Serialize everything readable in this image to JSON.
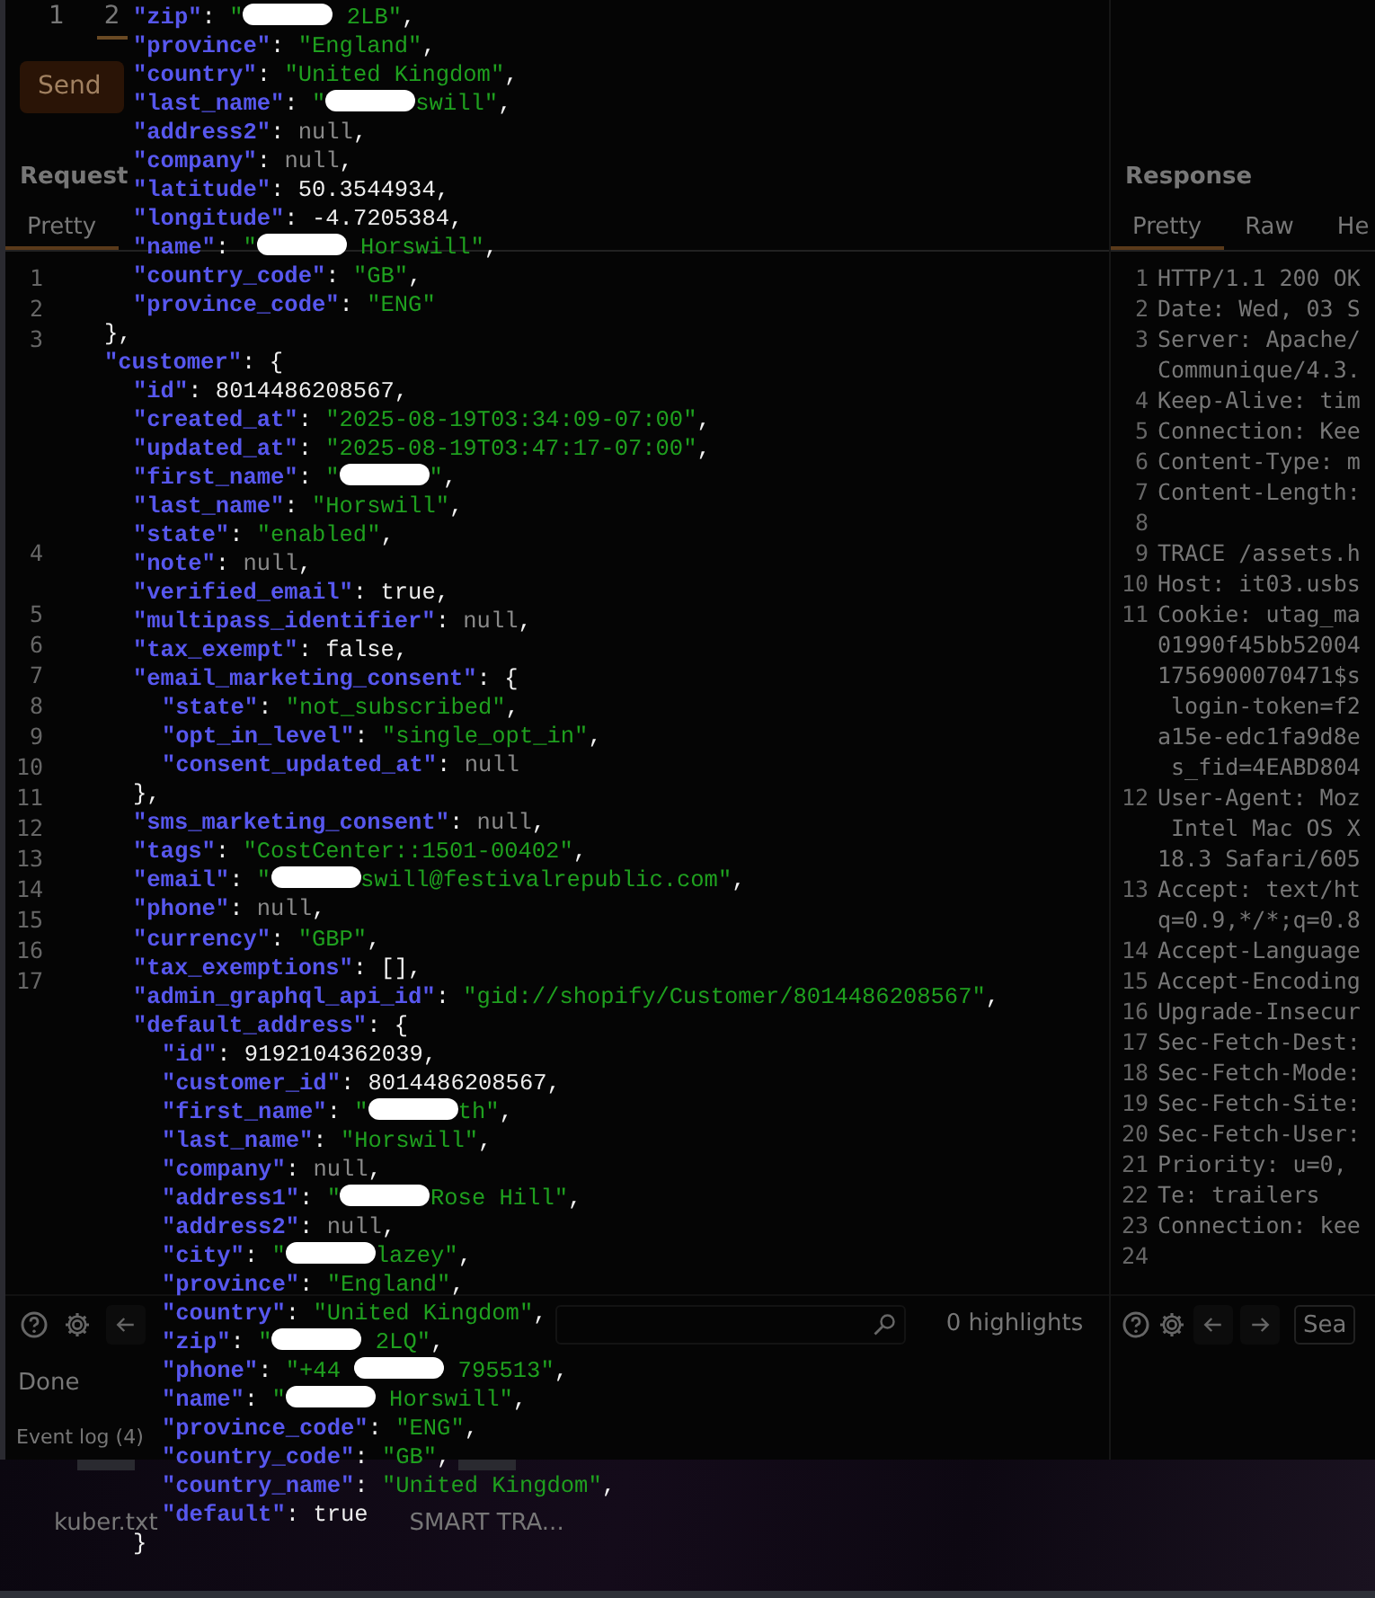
{
  "request_panel": {
    "tabs": [
      {
        "label": "1",
        "selected": false
      },
      {
        "label": "2",
        "selected": true
      }
    ],
    "send_button": "Send",
    "title": "Request",
    "view_tabs": [
      {
        "label": "Pretty",
        "selected": true
      }
    ],
    "gutter": [
      {
        "kind": "numbered",
        "number": "1"
      },
      {
        "kind": "numbered",
        "number": "2"
      },
      {
        "kind": "numbered",
        "number": "3"
      },
      {
        "kind": "continuation"
      },
      {
        "kind": "continuation"
      },
      {
        "kind": "continuation"
      },
      {
        "kind": "continuation"
      },
      {
        "kind": "continuation"
      },
      {
        "kind": "continuation"
      },
      {
        "kind": "numbered",
        "number": "4"
      },
      {
        "kind": "continuation"
      },
      {
        "kind": "numbered",
        "number": "5"
      },
      {
        "kind": "numbered",
        "number": "6"
      },
      {
        "kind": "numbered",
        "number": "7"
      },
      {
        "kind": "numbered",
        "number": "8"
      },
      {
        "kind": "numbered",
        "number": "9"
      },
      {
        "kind": "numbered",
        "number": "10"
      },
      {
        "kind": "numbered",
        "number": "11"
      },
      {
        "kind": "numbered",
        "number": "12"
      },
      {
        "kind": "numbered",
        "number": "13"
      },
      {
        "kind": "numbered",
        "number": "14"
      },
      {
        "kind": "numbered",
        "number": "15"
      },
      {
        "kind": "numbered",
        "number": "16"
      },
      {
        "kind": "numbered",
        "number": "17"
      }
    ],
    "highlights": "0 highlights",
    "status": "Done",
    "event_log": "Event log (4)"
  },
  "response_panel": {
    "title": "Response",
    "view_tabs": [
      {
        "label": "Pretty",
        "selected": true
      },
      {
        "label": "Raw",
        "selected": false
      },
      {
        "label": "He",
        "selected": false
      }
    ],
    "lines": [
      {
        "number": "1",
        "text": "HTTP/1.1 200 OK"
      },
      {
        "number": "2",
        "text": "Date: Wed, 03 S"
      },
      {
        "number": "3",
        "text": "Server: Apache/"
      },
      {
        "text": "Communique/4.3."
      },
      {
        "number": "4",
        "text": "Keep-Alive: tim"
      },
      {
        "number": "5",
        "text": "Connection: Kee"
      },
      {
        "number": "6",
        "text": "Content-Type: m"
      },
      {
        "number": "7",
        "text": "Content-Length:"
      },
      {
        "number": "8"
      },
      {
        "number": "9",
        "text": "TRACE /assets.h"
      },
      {
        "number": "10",
        "text": "Host: it03.usbs"
      },
      {
        "number": "11",
        "text": "Cookie: utag_ma"
      },
      {
        "text": "01990f45bb52004"
      },
      {
        "text": "1756900070471$s"
      },
      {
        "text": " login-token=f2"
      },
      {
        "text": "a15e-edc1fa9d8e"
      },
      {
        "text": " s_fid=4EABD804"
      },
      {
        "number": "12",
        "text": "User-Agent: Moz"
      },
      {
        "text": " Intel Mac OS X"
      },
      {
        "text": "18.3 Safari/605"
      },
      {
        "number": "13",
        "text": "Accept: text/ht"
      },
      {
        "text": "q=0.9,*/*;q=0.8"
      },
      {
        "number": "14",
        "text": "Accept-Language"
      },
      {
        "number": "15",
        "text": "Accept-Encoding"
      },
      {
        "number": "16",
        "text": "Upgrade-Insecur"
      },
      {
        "number": "17",
        "text": "Sec-Fetch-Dest:"
      },
      {
        "number": "18",
        "text": "Sec-Fetch-Mode:"
      },
      {
        "number": "19",
        "text": "Sec-Fetch-Site:"
      },
      {
        "number": "20",
        "text": "Sec-Fetch-User:"
      },
      {
        "number": "21",
        "text": "Priority: u=0,"
      },
      {
        "number": "22",
        "text": "Te: trailers"
      },
      {
        "number": "23",
        "text": "Connection: kee"
      },
      {
        "number": "24"
      }
    ],
    "search_placeholder": "Sea"
  },
  "desktop": {
    "files": [
      {
        "label": "kuber.txt"
      },
      {
        "label": "SMART TRA..."
      }
    ]
  },
  "json_overlay": {
    "items": [
      {
        "children": [
          {
            "tokens": [
              {
                "kind": "key",
                "t": "\"zip\""
              },
              {
                "kind": "punct",
                "t": ": "
              },
              {
                "kind": "string",
                "t": "\""
              },
              {
                "kind": "redaction"
              },
              {
                "kind": "string",
                "t": " 2LB\""
              },
              {
                "kind": "punct",
                "t": ","
              }
            ]
          },
          {
            "tokens": [
              {
                "kind": "key",
                "t": "\"province\""
              },
              {
                "kind": "punct",
                "t": ": "
              },
              {
                "kind": "string",
                "t": "\"England\""
              },
              {
                "kind": "punct",
                "t": ","
              }
            ]
          },
          {
            "tokens": [
              {
                "kind": "key",
                "t": "\"country\""
              },
              {
                "kind": "punct",
                "t": ": "
              },
              {
                "kind": "string",
                "t": "\"United Kingdom\""
              },
              {
                "kind": "punct",
                "t": ","
              }
            ]
          },
          {
            "tokens": [
              {
                "kind": "key",
                "t": "\"last_name\""
              },
              {
                "kind": "punct",
                "t": ": "
              },
              {
                "kind": "string",
                "t": "\""
              },
              {
                "kind": "redaction"
              },
              {
                "kind": "string",
                "t": "swill\""
              },
              {
                "kind": "punct",
                "t": ","
              }
            ]
          },
          {
            "tokens": [
              {
                "kind": "key",
                "t": "\"address2\""
              },
              {
                "kind": "punct",
                "t": ": "
              },
              {
                "kind": "null",
                "t": "null"
              },
              {
                "kind": "punct",
                "t": ","
              }
            ]
          },
          {
            "tokens": [
              {
                "kind": "key",
                "t": "\"company\""
              },
              {
                "kind": "punct",
                "t": ": "
              },
              {
                "kind": "null",
                "t": "null"
              },
              {
                "kind": "punct",
                "t": ","
              }
            ]
          },
          {
            "tokens": [
              {
                "kind": "key",
                "t": "\"latitude\""
              },
              {
                "kind": "punct",
                "t": ": "
              },
              {
                "kind": "number",
                "t": "50.3544934"
              },
              {
                "kind": "punct",
                "t": ","
              }
            ]
          },
          {
            "tokens": [
              {
                "kind": "key",
                "t": "\"longitude\""
              },
              {
                "kind": "punct",
                "t": ": "
              },
              {
                "kind": "number",
                "t": "-4.7205384"
              },
              {
                "kind": "punct",
                "t": ","
              }
            ]
          },
          {
            "tokens": [
              {
                "kind": "key",
                "t": "\"name\""
              },
              {
                "kind": "punct",
                "t": ": "
              },
              {
                "kind": "string",
                "t": "\""
              },
              {
                "kind": "redaction"
              },
              {
                "kind": "string",
                "t": " Horswill\""
              },
              {
                "kind": "punct",
                "t": ","
              }
            ]
          },
          {
            "tokens": [
              {
                "kind": "key",
                "t": "\"country_code\""
              },
              {
                "kind": "punct",
                "t": ": "
              },
              {
                "kind": "string",
                "t": "\"GB\""
              },
              {
                "kind": "punct",
                "t": ","
              }
            ]
          },
          {
            "tokens": [
              {
                "kind": "key",
                "t": "\"province_code\""
              },
              {
                "kind": "punct",
                "t": ": "
              },
              {
                "kind": "string",
                "t": "\"ENG\""
              }
            ]
          }
        ]
      },
      {
        "tokens": [
          {
            "kind": "punct",
            "t": "},"
          }
        ]
      },
      {
        "tokens": [
          {
            "kind": "key",
            "t": "\"customer\""
          },
          {
            "kind": "punct",
            "t": ": {"
          }
        ],
        "children": [
          {
            "tokens": [
              {
                "kind": "key",
                "t": "\"id\""
              },
              {
                "kind": "punct",
                "t": ": "
              },
              {
                "kind": "number",
                "t": "8014486208567"
              },
              {
                "kind": "punct",
                "t": ","
              }
            ]
          },
          {
            "tokens": [
              {
                "kind": "key",
                "t": "\"created_at\""
              },
              {
                "kind": "punct",
                "t": ": "
              },
              {
                "kind": "string",
                "t": "\"2025-08-19T03:34:09-07:00\""
              },
              {
                "kind": "punct",
                "t": ","
              }
            ]
          },
          {
            "tokens": [
              {
                "kind": "key",
                "t": "\"updated_at\""
              },
              {
                "kind": "punct",
                "t": ": "
              },
              {
                "kind": "string",
                "t": "\"2025-08-19T03:47:17-07:00\""
              },
              {
                "kind": "punct",
                "t": ","
              }
            ]
          },
          {
            "tokens": [
              {
                "kind": "key",
                "t": "\"first_name\""
              },
              {
                "kind": "punct",
                "t": ": "
              },
              {
                "kind": "string",
                "t": "\""
              },
              {
                "kind": "redaction"
              },
              {
                "kind": "string",
                "t": "\""
              },
              {
                "kind": "punct",
                "t": ","
              }
            ]
          },
          {
            "tokens": [
              {
                "kind": "key",
                "t": "\"last_name\""
              },
              {
                "kind": "punct",
                "t": ": "
              },
              {
                "kind": "string",
                "t": "\"Horswill\""
              },
              {
                "kind": "punct",
                "t": ","
              }
            ]
          },
          {
            "tokens": [
              {
                "kind": "key",
                "t": "\"state\""
              },
              {
                "kind": "punct",
                "t": ": "
              },
              {
                "kind": "string",
                "t": "\"enabled\""
              },
              {
                "kind": "punct",
                "t": ","
              }
            ]
          },
          {
            "tokens": [
              {
                "kind": "key",
                "t": "\"note\""
              },
              {
                "kind": "punct",
                "t": ": "
              },
              {
                "kind": "null",
                "t": "null"
              },
              {
                "kind": "punct",
                "t": ","
              }
            ]
          },
          {
            "tokens": [
              {
                "kind": "key",
                "t": "\"verified_email\""
              },
              {
                "kind": "punct",
                "t": ": "
              },
              {
                "kind": "bool",
                "t": "true"
              },
              {
                "kind": "punct",
                "t": ","
              }
            ]
          },
          {
            "tokens": [
              {
                "kind": "key",
                "t": "\"multipass_identifier\""
              },
              {
                "kind": "punct",
                "t": ": "
              },
              {
                "kind": "null",
                "t": "null"
              },
              {
                "kind": "punct",
                "t": ","
              }
            ]
          },
          {
            "tokens": [
              {
                "kind": "key",
                "t": "\"tax_exempt\""
              },
              {
                "kind": "punct",
                "t": ": "
              },
              {
                "kind": "bool",
                "t": "false"
              },
              {
                "kind": "punct",
                "t": ","
              }
            ]
          },
          {
            "tokens": [
              {
                "kind": "key",
                "t": "\"email_marketing_consent\""
              },
              {
                "kind": "punct",
                "t": ": {"
              }
            ],
            "children": [
              {
                "tokens": [
                  {
                    "kind": "key",
                    "t": "\"state\""
                  },
                  {
                    "kind": "punct",
                    "t": ": "
                  },
                  {
                    "kind": "string",
                    "t": "\"not_subscribed\""
                  },
                  {
                    "kind": "punct",
                    "t": ","
                  }
                ]
              },
              {
                "tokens": [
                  {
                    "kind": "key",
                    "t": "\"opt_in_level\""
                  },
                  {
                    "kind": "punct",
                    "t": ": "
                  },
                  {
                    "kind": "string",
                    "t": "\"single_opt_in\""
                  },
                  {
                    "kind": "punct",
                    "t": ","
                  }
                ]
              },
              {
                "tokens": [
                  {
                    "kind": "key",
                    "t": "\"consent_updated_at\""
                  },
                  {
                    "kind": "punct",
                    "t": ": "
                  },
                  {
                    "kind": "null",
                    "t": "null"
                  }
                ]
              }
            ]
          },
          {
            "tokens": [
              {
                "kind": "punct",
                "t": "},"
              }
            ]
          },
          {
            "tokens": [
              {
                "kind": "key",
                "t": "\"sms_marketing_consent\""
              },
              {
                "kind": "punct",
                "t": ": "
              },
              {
                "kind": "null",
                "t": "null"
              },
              {
                "kind": "punct",
                "t": ","
              }
            ]
          },
          {
            "tokens": [
              {
                "kind": "key",
                "t": "\"tags\""
              },
              {
                "kind": "punct",
                "t": ": "
              },
              {
                "kind": "string",
                "t": "\"CostCenter::1501-00402\""
              },
              {
                "kind": "punct",
                "t": ","
              }
            ]
          },
          {
            "tokens": [
              {
                "kind": "key",
                "t": "\"email\""
              },
              {
                "kind": "punct",
                "t": ": "
              },
              {
                "kind": "string",
                "t": "\""
              },
              {
                "kind": "redaction"
              },
              {
                "kind": "string",
                "t": "swill@festivalrepublic.com\""
              },
              {
                "kind": "punct",
                "t": ","
              }
            ]
          },
          {
            "tokens": [
              {
                "kind": "key",
                "t": "\"phone\""
              },
              {
                "kind": "punct",
                "t": ": "
              },
              {
                "kind": "null",
                "t": "null"
              },
              {
                "kind": "punct",
                "t": ","
              }
            ]
          },
          {
            "tokens": [
              {
                "kind": "key",
                "t": "\"currency\""
              },
              {
                "kind": "punct",
                "t": ": "
              },
              {
                "kind": "string",
                "t": "\"GBP\""
              },
              {
                "kind": "punct",
                "t": ","
              }
            ]
          },
          {
            "tokens": [
              {
                "kind": "key",
                "t": "\"tax_exemptions\""
              },
              {
                "kind": "punct",
                "t": ": [],"
              }
            ]
          },
          {
            "tokens": [
              {
                "kind": "key",
                "t": "\"admin_graphql_api_id\""
              },
              {
                "kind": "punct",
                "t": ": "
              },
              {
                "kind": "string",
                "t": "\"gid://shopify/Customer/8014486208567\""
              },
              {
                "kind": "punct",
                "t": ","
              }
            ]
          },
          {
            "tokens": [
              {
                "kind": "key",
                "t": "\"default_address\""
              },
              {
                "kind": "punct",
                "t": ": {"
              }
            ],
            "children": [
              {
                "tokens": [
                  {
                    "kind": "key",
                    "t": "\"id\""
                  },
                  {
                    "kind": "punct",
                    "t": ": "
                  },
                  {
                    "kind": "number",
                    "t": "9192104362039"
                  },
                  {
                    "kind": "punct",
                    "t": ","
                  }
                ]
              },
              {
                "tokens": [
                  {
                    "kind": "key",
                    "t": "\"customer_id\""
                  },
                  {
                    "kind": "punct",
                    "t": ": "
                  },
                  {
                    "kind": "number",
                    "t": "8014486208567"
                  },
                  {
                    "kind": "punct",
                    "t": ","
                  }
                ]
              },
              {
                "tokens": [
                  {
                    "kind": "key",
                    "t": "\"first_name\""
                  },
                  {
                    "kind": "punct",
                    "t": ": "
                  },
                  {
                    "kind": "string",
                    "t": "\""
                  },
                  {
                    "kind": "redaction"
                  },
                  {
                    "kind": "string",
                    "t": "th\""
                  },
                  {
                    "kind": "punct",
                    "t": ","
                  }
                ]
              },
              {
                "tokens": [
                  {
                    "kind": "key",
                    "t": "\"last_name\""
                  },
                  {
                    "kind": "punct",
                    "t": ": "
                  },
                  {
                    "kind": "string",
                    "t": "\"Horswill\""
                  },
                  {
                    "kind": "punct",
                    "t": ","
                  }
                ]
              },
              {
                "tokens": [
                  {
                    "kind": "key",
                    "t": "\"company\""
                  },
                  {
                    "kind": "punct",
                    "t": ": "
                  },
                  {
                    "kind": "null",
                    "t": "null"
                  },
                  {
                    "kind": "punct",
                    "t": ","
                  }
                ]
              },
              {
                "tokens": [
                  {
                    "kind": "key",
                    "t": "\"address1\""
                  },
                  {
                    "kind": "punct",
                    "t": ": "
                  },
                  {
                    "kind": "string",
                    "t": "\""
                  },
                  {
                    "kind": "redaction"
                  },
                  {
                    "kind": "string",
                    "t": "Rose Hill\""
                  },
                  {
                    "kind": "punct",
                    "t": ","
                  }
                ]
              },
              {
                "tokens": [
                  {
                    "kind": "key",
                    "t": "\"address2\""
                  },
                  {
                    "kind": "punct",
                    "t": ": "
                  },
                  {
                    "kind": "null",
                    "t": "null"
                  },
                  {
                    "kind": "punct",
                    "t": ","
                  }
                ]
              },
              {
                "tokens": [
                  {
                    "kind": "key",
                    "t": "\"city\""
                  },
                  {
                    "kind": "punct",
                    "t": ": "
                  },
                  {
                    "kind": "string",
                    "t": "\""
                  },
                  {
                    "kind": "redaction"
                  },
                  {
                    "kind": "string",
                    "t": "lazey\""
                  },
                  {
                    "kind": "punct",
                    "t": ","
                  }
                ]
              },
              {
                "tokens": [
                  {
                    "kind": "key",
                    "t": "\"province\""
                  },
                  {
                    "kind": "punct",
                    "t": ": "
                  },
                  {
                    "kind": "string",
                    "t": "\"England\""
                  },
                  {
                    "kind": "punct",
                    "t": ","
                  }
                ]
              },
              {
                "tokens": [
                  {
                    "kind": "key",
                    "t": "\"country\""
                  },
                  {
                    "kind": "punct",
                    "t": ": "
                  },
                  {
                    "kind": "string",
                    "t": "\"United Kingdom\""
                  },
                  {
                    "kind": "punct",
                    "t": ","
                  }
                ]
              },
              {
                "tokens": [
                  {
                    "kind": "key",
                    "t": "\"zip\""
                  },
                  {
                    "kind": "punct",
                    "t": ": "
                  },
                  {
                    "kind": "string",
                    "t": "\""
                  },
                  {
                    "kind": "redaction"
                  },
                  {
                    "kind": "string",
                    "t": " 2LQ\""
                  },
                  {
                    "kind": "punct",
                    "t": ","
                  }
                ]
              },
              {
                "tokens": [
                  {
                    "kind": "key",
                    "t": "\"phone\""
                  },
                  {
                    "kind": "punct",
                    "t": ": "
                  },
                  {
                    "kind": "string",
                    "t": "\"+44 "
                  },
                  {
                    "kind": "redaction"
                  },
                  {
                    "kind": "string",
                    "t": " 795513\""
                  },
                  {
                    "kind": "punct",
                    "t": ","
                  }
                ]
              },
              {
                "tokens": [
                  {
                    "kind": "key",
                    "t": "\"name\""
                  },
                  {
                    "kind": "punct",
                    "t": ": "
                  },
                  {
                    "kind": "string",
                    "t": "\""
                  },
                  {
                    "kind": "redaction"
                  },
                  {
                    "kind": "string",
                    "t": " Horswill\""
                  },
                  {
                    "kind": "punct",
                    "t": ","
                  }
                ]
              },
              {
                "tokens": [
                  {
                    "kind": "key",
                    "t": "\"province_code\""
                  },
                  {
                    "kind": "punct",
                    "t": ": "
                  },
                  {
                    "kind": "string",
                    "t": "\"ENG\""
                  },
                  {
                    "kind": "punct",
                    "t": ","
                  }
                ]
              },
              {
                "tokens": [
                  {
                    "kind": "key",
                    "t": "\"country_code\""
                  },
                  {
                    "kind": "punct",
                    "t": ": "
                  },
                  {
                    "kind": "string",
                    "t": "\"GB\""
                  },
                  {
                    "kind": "punct",
                    "t": ","
                  }
                ]
              },
              {
                "tokens": [
                  {
                    "kind": "key",
                    "t": "\"country_name\""
                  },
                  {
                    "kind": "punct",
                    "t": ": "
                  },
                  {
                    "kind": "string",
                    "t": "\"United Kingdom\""
                  },
                  {
                    "kind": "punct",
                    "t": ","
                  }
                ]
              },
              {
                "tokens": [
                  {
                    "kind": "key",
                    "t": "\"default\""
                  },
                  {
                    "kind": "punct",
                    "t": ": "
                  },
                  {
                    "kind": "bool",
                    "t": "true"
                  }
                ]
              }
            ]
          },
          {
            "tokens": [
              {
                "kind": "punct",
                "t": "}"
              }
            ]
          }
        ]
      }
    ]
  }
}
